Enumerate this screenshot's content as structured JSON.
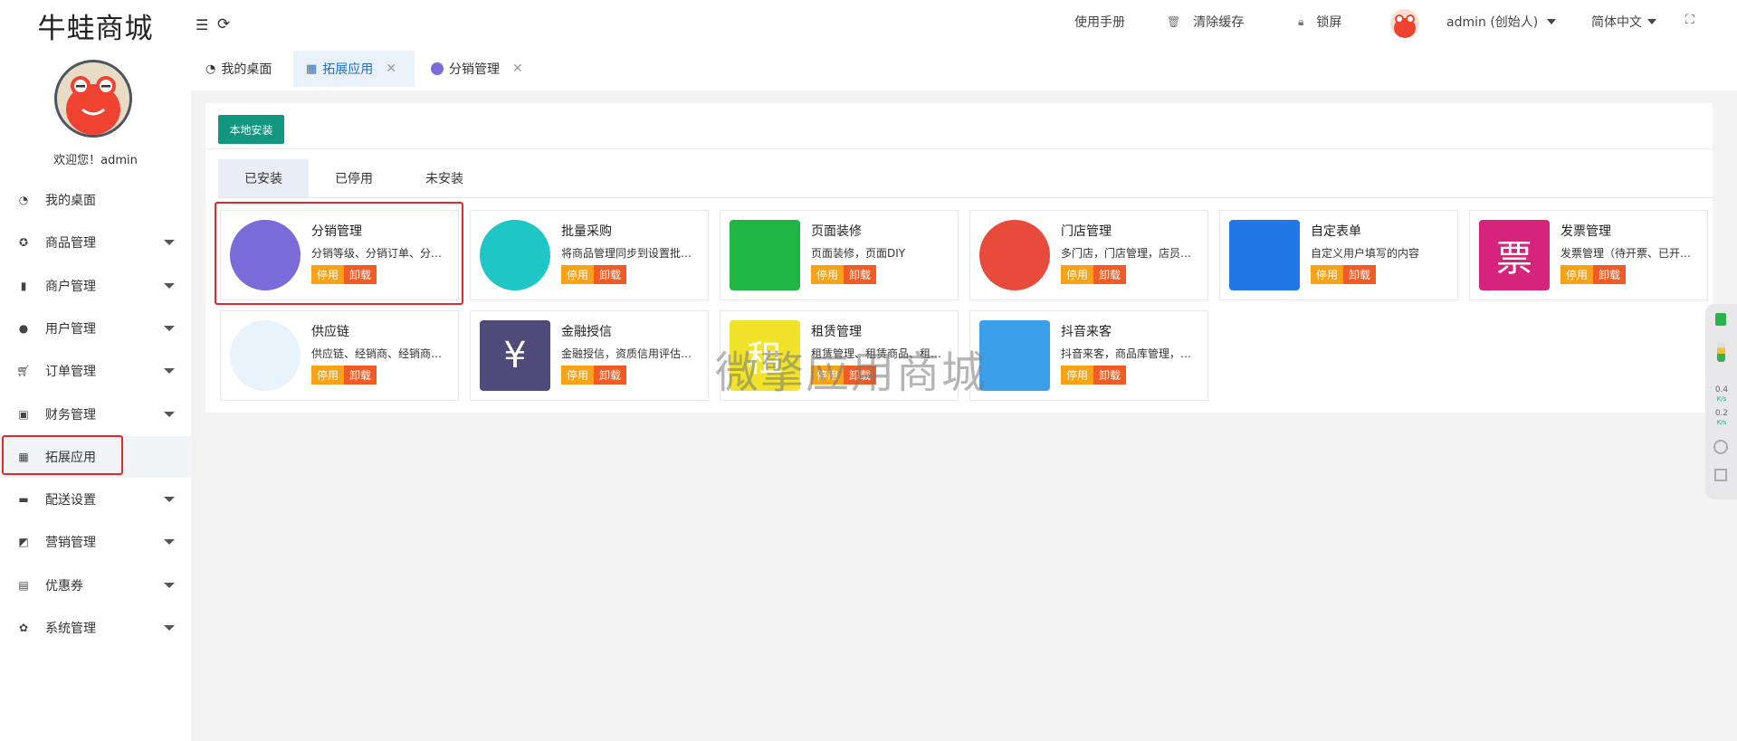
{
  "brand": {
    "logo": "牛蛙商城",
    "welcome": "欢迎您！admin"
  },
  "sidebar": {
    "items": [
      {
        "name": "desktop",
        "label": "我的桌面",
        "icon": "dashboard-icon",
        "arrow": false
      },
      {
        "name": "goods",
        "label": "商品管理",
        "icon": "goods-icon",
        "arrow": true
      },
      {
        "name": "merchant",
        "label": "商户管理",
        "icon": "merchant-icon",
        "arrow": true
      },
      {
        "name": "user",
        "label": "用户管理",
        "icon": "user-icon",
        "arrow": true
      },
      {
        "name": "order",
        "label": "订单管理",
        "icon": "cart-icon",
        "arrow": true
      },
      {
        "name": "finance",
        "label": "财务管理",
        "icon": "money-icon",
        "arrow": true
      },
      {
        "name": "extension",
        "label": "拓展应用",
        "icon": "grid-icon",
        "arrow": false,
        "active": true
      },
      {
        "name": "delivery",
        "label": "配送设置",
        "icon": "truck-icon",
        "arrow": true
      },
      {
        "name": "marketing",
        "label": "营销管理",
        "icon": "marketing-icon",
        "arrow": true
      },
      {
        "name": "coupon",
        "label": "优惠券",
        "icon": "ticket-icon",
        "arrow": true
      },
      {
        "name": "system",
        "label": "系统管理",
        "icon": "gear-icon",
        "arrow": true
      }
    ]
  },
  "header": {
    "manual": "使用手册",
    "clear_cache": "清除缓存",
    "lock": "锁屏",
    "user": "admin (创始人)",
    "language": "简体中文"
  },
  "tabs": [
    {
      "label": "我的桌面",
      "icon": "dashboard-icon",
      "closable": false
    },
    {
      "label": "拓展应用",
      "icon": "grid-icon",
      "closable": true,
      "active": true
    },
    {
      "label": "分销管理",
      "icon": "distribution-icon",
      "closable": true
    }
  ],
  "main": {
    "local_install": "本地安装",
    "subtabs": [
      "已安装",
      "已停用",
      "未安装"
    ],
    "disable_label": "停用",
    "uninstall_label": "卸载",
    "apps": [
      {
        "title": "分销管理",
        "desc": "分销等级、分销订单、分销商",
        "icon": "distribution-icon",
        "bg": "#7a6bd8"
      },
      {
        "title": "批量采购",
        "desc": "将商品管理同步到设置批量采购",
        "icon": "document-icon",
        "bg": "#1ec6c6"
      },
      {
        "title": "页面装修",
        "desc": "页面装修，页面DIY",
        "icon": "paint-roller-icon",
        "bg": "#1eb543"
      },
      {
        "title": "门店管理",
        "desc": "多门店，门店管理，店员管理",
        "icon": "store-icon",
        "bg": "#e84b3c"
      },
      {
        "title": "自定表单",
        "desc": "自定义用户填写的内容",
        "icon": "checklist-icon",
        "bg": "#2277e6"
      },
      {
        "title": "发票管理",
        "desc": "发票管理（待开票、已开票）",
        "icon": "invoice-icon",
        "bg": "#d6247c",
        "glyph": "票"
      },
      {
        "title": "供应链",
        "desc": "供应链、经销商、经销商管理",
        "icon": "network-icon",
        "bg": "#e8f3fb"
      },
      {
        "title": "金融授信",
        "desc": "金融授信，资质信用评估管理",
        "icon": "yen-badge-icon",
        "bg": "#4f4a7a",
        "glyph": "¥"
      },
      {
        "title": "租赁管理",
        "desc": "租赁管理、租赁商品、租赁订单",
        "icon": "rent-icon",
        "bg": "#f0e32a",
        "glyph": "租"
      },
      {
        "title": "抖音来客",
        "desc": "抖音来客，商品库管理，订单",
        "icon": "douyin-icon",
        "bg": "#3b9ee8"
      }
    ]
  },
  "watermark": "微擎应用商城",
  "side_widget": {
    "up_speed": "0.4",
    "down_speed": "0.2",
    "unit": "K/s"
  },
  "colors": {
    "primary": "#11967f",
    "accent_blue": "#1e6fcf",
    "disable": "#f8a216",
    "uninstall": "#f25b24",
    "highlight": "#e02b2b"
  }
}
